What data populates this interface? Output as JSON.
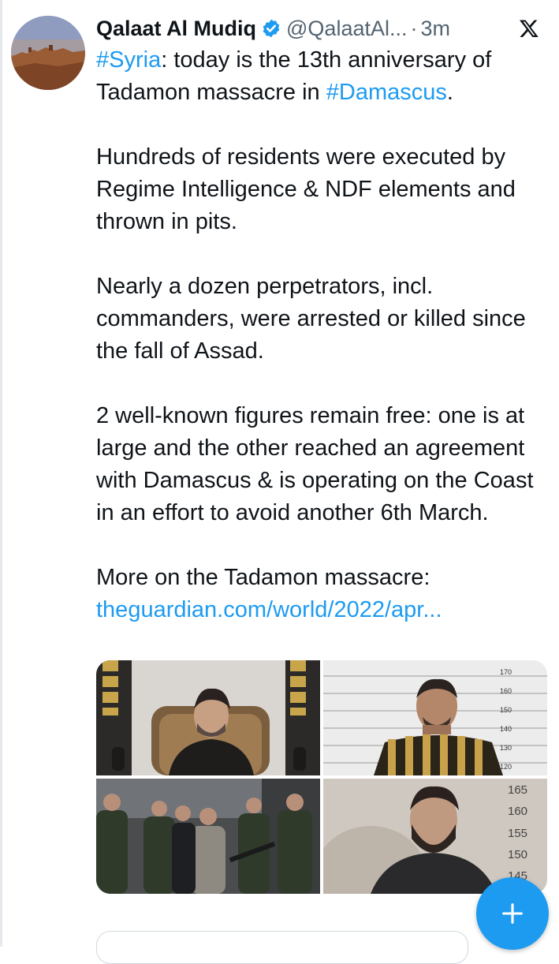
{
  "tweet": {
    "author_name": "Qalaat Al Mudiq",
    "handle": "@QalaatAl...",
    "separator": "·",
    "time": "3m",
    "icons": {
      "verified": "verified-badge-icon",
      "platform": "x-logo-icon",
      "compose": "plus-icon"
    },
    "body": {
      "p1_hashtag1": "#Syria",
      "p1_text1": ": today is the 13th anniversary of Tadamon massacre in ",
      "p1_hashtag2": "#Damascus",
      "p1_text2": ".",
      "p2": "Hundreds of residents were executed by Regime Intelligence & NDF elements and thrown in pits.",
      "p3": "Nearly a dozen perpetrators, incl. commanders, were arrested or killed since the fall of Assad.",
      "p4": "2 well-known figures remain free: one is at large and the other reached an agreement with Damascus & is operating on the Coast in an effort to avoid another 6th March.",
      "p5": "More on the Tadamon massacre:",
      "link": "theguardian.com/world/2022/apr..."
    },
    "media": {
      "mugshot1_scale": [
        "170",
        "160",
        "150",
        "140",
        "130",
        "120"
      ],
      "mugshot2_scale": [
        "165",
        "160",
        "155",
        "150",
        "145"
      ]
    }
  },
  "colors": {
    "accent": "#1d9bf0",
    "text": "#0f1419",
    "muted": "#536471"
  }
}
